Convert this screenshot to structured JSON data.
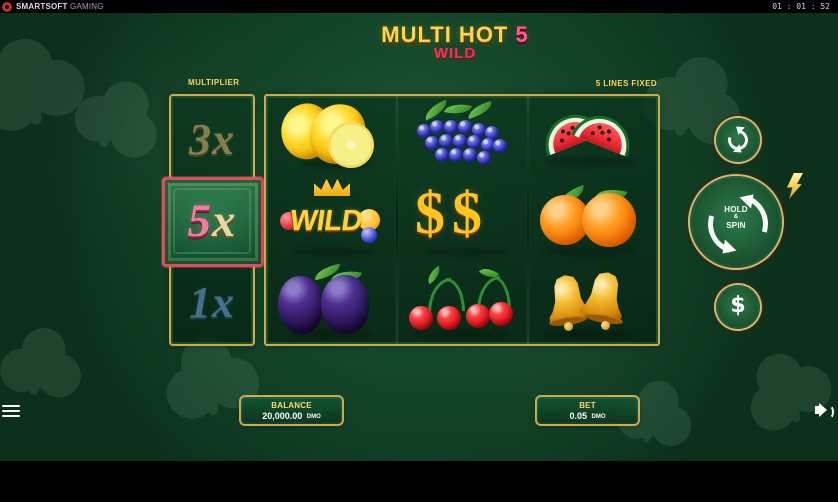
{
  "system": {
    "brand_name": "SMARTSOFT",
    "brand_sub": "GAMING",
    "clock": "01 : 01 : 52"
  },
  "title": {
    "main": "MULTI HOT",
    "number": "5",
    "sub": "WILD"
  },
  "labels": {
    "multiplier": "MULTIPLIER",
    "lines": "5 LINES FIXED"
  },
  "multiplier": {
    "top": "3x",
    "active_number": "5",
    "active_suffix": "x",
    "bottom": "1x"
  },
  "wild_symbol": {
    "text": "WILD"
  },
  "reel_symbols": [
    [
      "lemons",
      "wild",
      "plums"
    ],
    [
      "grapes",
      "dollars",
      "cherries"
    ],
    [
      "watermelon",
      "oranges",
      "bells"
    ]
  ],
  "controls": {
    "hold_line1": "HOLD",
    "hold_line2": "&",
    "hold_line3": "SPIN",
    "money_symbol": "$"
  },
  "footer": {
    "balance_label": "BALANCE",
    "balance_value": "20,000.00",
    "balance_unit": "DMO",
    "bet_label": "BET",
    "bet_value": "0.05",
    "bet_unit": "DMO"
  },
  "icons": {
    "autoplay": "refresh-icon",
    "hold": "hold-spin-icon",
    "money": "dollar-icon",
    "menu": "menu-icon",
    "sound": "speaker-icon",
    "lightning": "bolt-icon"
  },
  "colors": {
    "background_green": "#124428",
    "gold": "#d9b051",
    "active_multiplier": "#f77a9b",
    "title_gold": "#ffd54f",
    "title_red": "#ff2f4e"
  }
}
